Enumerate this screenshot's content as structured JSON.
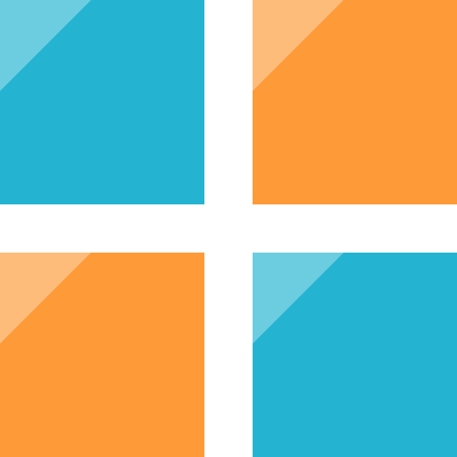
{
  "icon": {
    "name": "four-square-grid-icon",
    "background_color": "#ffffff",
    "tiles": [
      {
        "name": "tile-top-left",
        "color": "#24b4d1",
        "highlight_color": "#6ccde1"
      },
      {
        "name": "tile-top-right",
        "color": "#fe9a37",
        "highlight_color": "#febc7b"
      },
      {
        "name": "tile-bottom-left",
        "color": "#fe9a37",
        "highlight_color": "#febc7b"
      },
      {
        "name": "tile-bottom-right",
        "color": "#24b4d1",
        "highlight_color": "#6ccde1"
      }
    ]
  }
}
